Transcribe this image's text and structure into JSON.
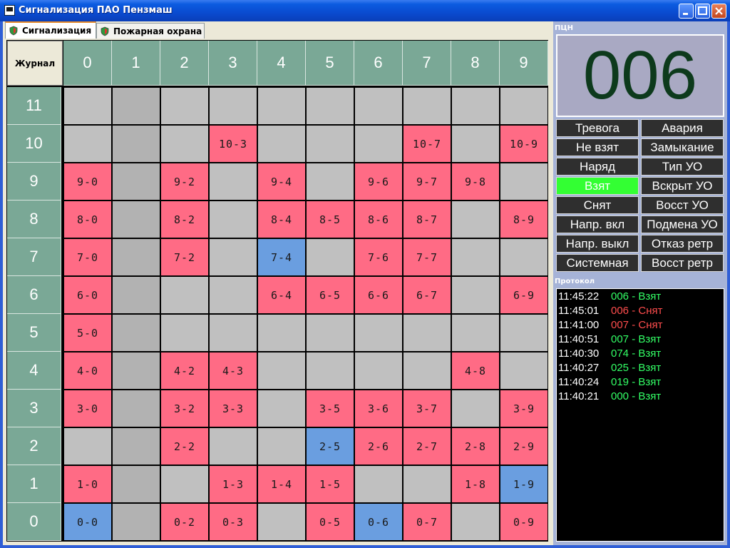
{
  "window": {
    "title": "Сигнализация ПАО Пензмаш"
  },
  "tabs": [
    {
      "label": "Сигнализация",
      "active": true
    },
    {
      "label": "Пожарная охрана",
      "active": false
    }
  ],
  "grid": {
    "corner_label": "Журнал",
    "columns": [
      "0",
      "1",
      "2",
      "3",
      "4",
      "5",
      "6",
      "7",
      "8",
      "9"
    ],
    "rows": [
      "11",
      "10",
      "9",
      "8",
      "7",
      "6",
      "5",
      "4",
      "3",
      "2",
      "1",
      "0"
    ],
    "colors": {
      "alarm": "#ff6b85",
      "taken": "#6a9ee0",
      "empty": "#c0c0c0",
      "empty_dark": "#b2b2b2"
    },
    "cells": [
      [
        "",
        "",
        "",
        "",
        "",
        "",
        "",
        "",
        "",
        ""
      ],
      [
        "",
        "",
        "",
        "10-3",
        "",
        "",
        "",
        "10-7",
        "",
        "10-9"
      ],
      [
        "9-0",
        "",
        "9-2",
        "",
        "9-4",
        "",
        "9-6",
        "9-7",
        "9-8",
        ""
      ],
      [
        "8-0",
        "",
        "8-2",
        "",
        "8-4",
        "8-5",
        "8-6",
        "8-7",
        "",
        "8-9"
      ],
      [
        "7-0",
        "",
        "7-2",
        "",
        "7-4",
        "",
        "7-6",
        "7-7",
        "",
        ""
      ],
      [
        "6-0",
        "",
        "",
        "",
        "6-4",
        "6-5",
        "6-6",
        "6-7",
        "",
        "6-9"
      ],
      [
        "5-0",
        "",
        "",
        "",
        "",
        "",
        "",
        "",
        "",
        ""
      ],
      [
        "4-0",
        "",
        "4-2",
        "4-3",
        "",
        "",
        "",
        "",
        "4-8",
        ""
      ],
      [
        "3-0",
        "",
        "3-2",
        "3-3",
        "",
        "3-5",
        "3-6",
        "3-7",
        "",
        "3-9"
      ],
      [
        "",
        "",
        "2-2",
        "",
        "",
        "2-5",
        "2-6",
        "2-7",
        "2-8",
        "2-9"
      ],
      [
        "1-0",
        "",
        "",
        "1-3",
        "1-4",
        "1-5",
        "",
        "",
        "1-8",
        "1-9"
      ],
      [
        "0-0",
        "",
        "0-2",
        "0-3",
        "",
        "0-5",
        "0-6",
        "0-7",
        "",
        "0-9"
      ]
    ],
    "states": [
      [
        "e",
        "e",
        "e",
        "e",
        "e",
        "e",
        "e",
        "e",
        "e",
        "e"
      ],
      [
        "e",
        "e",
        "e",
        "a",
        "e",
        "e",
        "e",
        "a",
        "e",
        "a"
      ],
      [
        "a",
        "e",
        "a",
        "e",
        "a",
        "e",
        "a",
        "a",
        "a",
        "e"
      ],
      [
        "a",
        "e",
        "a",
        "e",
        "a",
        "a",
        "a",
        "a",
        "e",
        "a"
      ],
      [
        "a",
        "e",
        "a",
        "e",
        "t",
        "e",
        "a",
        "a",
        "e",
        "e"
      ],
      [
        "a",
        "e",
        "e",
        "e",
        "a",
        "a",
        "a",
        "a",
        "e",
        "a"
      ],
      [
        "a",
        "e",
        "e",
        "e",
        "e",
        "e",
        "e",
        "e",
        "e",
        "e"
      ],
      [
        "a",
        "e",
        "a",
        "a",
        "e",
        "e",
        "e",
        "e",
        "a",
        "e"
      ],
      [
        "a",
        "e",
        "a",
        "a",
        "e",
        "a",
        "a",
        "a",
        "e",
        "a"
      ],
      [
        "e",
        "e",
        "a",
        "e",
        "e",
        "t",
        "a",
        "a",
        "a",
        "a"
      ],
      [
        "a",
        "e",
        "e",
        "a",
        "a",
        "a",
        "e",
        "e",
        "a",
        "t"
      ],
      [
        "t",
        "e",
        "a",
        "a",
        "e",
        "a",
        "t",
        "a",
        "e",
        "a"
      ]
    ]
  },
  "panel": {
    "pcn_label": "ПЦН",
    "display_value": "006",
    "buttons": [
      [
        "Тревога",
        "Авария"
      ],
      [
        "Не взят",
        "Замыкание"
      ],
      [
        "Наряд",
        "Тип УО"
      ],
      [
        "Взят",
        "Вскрыт УО"
      ],
      [
        "Снят",
        "Восст УО"
      ],
      [
        "Напр. вкл",
        "Подмена УО"
      ],
      [
        "Напр. выкл",
        "Отказ ретр"
      ],
      [
        "Системная",
        "Восст ретр"
      ]
    ],
    "active_button": "Взят",
    "protocol_label": "Протокол",
    "log": [
      {
        "time": "11:45:22",
        "msg": "006 - Взят",
        "color": "#33ff66"
      },
      {
        "time": "11:45:01",
        "msg": "006 - Снят",
        "color": "#ff4d4d"
      },
      {
        "time": "11:41:00",
        "msg": "007 - Снят",
        "color": "#ff4d4d"
      },
      {
        "time": "11:40:51",
        "msg": "007 - Взят",
        "color": "#33ff66"
      },
      {
        "time": "11:40:30",
        "msg": "074 - Взят",
        "color": "#33ff66"
      },
      {
        "time": "11:40:27",
        "msg": "025 - Взят",
        "color": "#33ff66"
      },
      {
        "time": "11:40:24",
        "msg": "019 - Взят",
        "color": "#33ff66"
      },
      {
        "time": "11:40:21",
        "msg": "000 - Взят",
        "color": "#33ff66"
      }
    ]
  }
}
